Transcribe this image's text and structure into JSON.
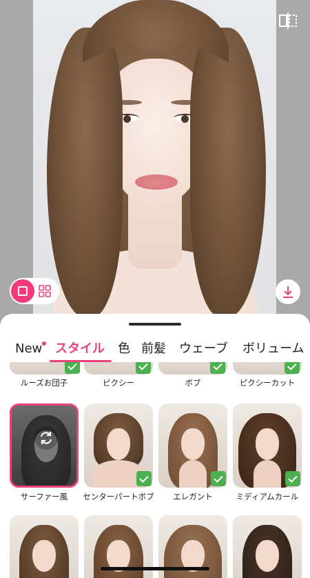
{
  "tabs": [
    {
      "label": "New",
      "has_dot": true
    },
    {
      "label": "スタイル",
      "active": true
    },
    {
      "label": "色"
    },
    {
      "label": "前髪"
    },
    {
      "label": "ウェーブ"
    },
    {
      "label": "ボリューム"
    }
  ],
  "row1": [
    {
      "label": "ルーズお団子",
      "checked": true
    },
    {
      "label": "ピクシー",
      "checked": true
    },
    {
      "label": "ボブ",
      "checked": true
    },
    {
      "label": "ピクシーカット",
      "checked": true
    }
  ],
  "row2": [
    {
      "label": "サーファー風",
      "selected": true,
      "checked": false
    },
    {
      "label": "センターパートボブ",
      "checked": true
    },
    {
      "label": "エレガント",
      "checked": true
    },
    {
      "label": "ミディアムカール",
      "checked": true
    }
  ],
  "icons": {
    "compare": "compare-icon",
    "single_view": "single-view-icon",
    "grid_view": "grid-view-icon",
    "download": "download-icon",
    "sync": "sync-icon",
    "check": "check-icon"
  },
  "colors": {
    "accent": "#e8417c",
    "check": "#4caf50"
  }
}
